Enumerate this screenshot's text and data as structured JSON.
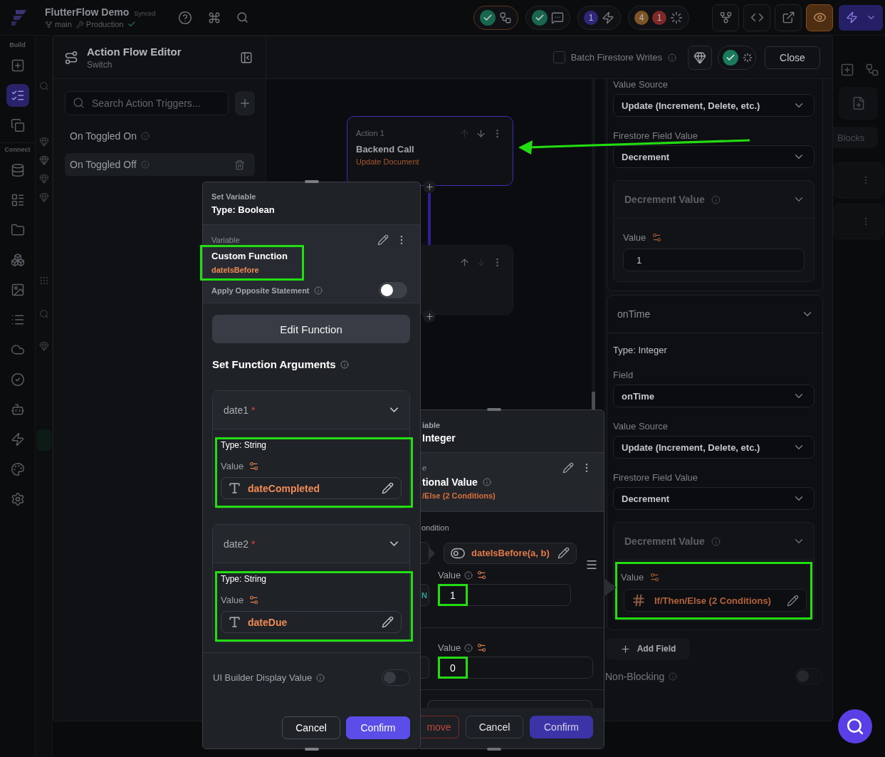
{
  "app_bar": {
    "project": "FlutterFlow Demo",
    "sync_status": "Synced",
    "branch": "main",
    "environment": "Production",
    "status_pills": [
      {
        "kind": "validation",
        "selected": true
      },
      {
        "kind": "comments",
        "selected": false
      },
      {
        "kind": "actions",
        "selected": false,
        "counts": [
          {
            "text": "1",
            "color": "#2f287a"
          }
        ]
      },
      {
        "kind": "issues",
        "selected": false,
        "counts": [
          {
            "text": "4",
            "color": "#7d5426"
          },
          {
            "text": "1",
            "color": "#7e2828"
          }
        ]
      }
    ],
    "tools": [
      {
        "kind": "branch",
        "on": false
      },
      {
        "kind": "code",
        "on": false
      },
      {
        "kind": "open",
        "on": false
      },
      {
        "kind": "preview",
        "on": true
      }
    ]
  },
  "rail": {
    "sections": [
      {
        "label": "Build",
        "items": [
          {
            "kind": "add-widget",
            "selected": false
          },
          {
            "kind": "widget-tree",
            "selected": true
          },
          {
            "kind": "components",
            "selected": false
          }
        ]
      },
      {
        "label": "Connect",
        "items": [
          {
            "kind": "database",
            "selected": false
          },
          {
            "kind": "schema",
            "selected": false
          },
          {
            "kind": "storage",
            "selected": false
          },
          {
            "kind": "integrations",
            "selected": false
          },
          {
            "kind": "media",
            "selected": false
          },
          {
            "kind": "text",
            "selected": false
          },
          {
            "kind": "cloud",
            "selected": false
          },
          {
            "kind": "tests",
            "selected": false
          },
          {
            "kind": "agent",
            "selected": false
          },
          {
            "kind": "actions",
            "selected": false
          },
          {
            "kind": "theme",
            "selected": false
          },
          {
            "kind": "settings",
            "selected": false
          }
        ]
      }
    ]
  },
  "backdrop": {
    "tab_label": "Blocks"
  },
  "action_flow_editor": {
    "title": "Action Flow Editor",
    "subtitle": "Switch",
    "batch_writes": {
      "label": "Batch Firestore Writes",
      "checked": false
    },
    "close_label": "Close",
    "trigger_search": {
      "placeholder": "Search Action Triggers..."
    },
    "triggers": [
      {
        "label": "On Toggled On",
        "selected": false
      },
      {
        "label": "On Toggled Off",
        "selected": true
      }
    ],
    "nodes": [
      {
        "caption": "Action 1",
        "title": "Backend Call",
        "subtitle": "Update Document",
        "selected": true,
        "can_move_up": false,
        "can_move_down": true
      },
      {
        "selected": false,
        "can_move_up": true,
        "can_move_down": false
      }
    ],
    "annotation_arrow": true
  },
  "update_fields": {
    "groups": [
      {
        "items": [
          {
            "kind": "select",
            "label": "Value Source",
            "value": "Update (Increment, Delete, etc.)"
          },
          {
            "kind": "select",
            "label": "Firestore Field Value",
            "value": "Decrement"
          },
          {
            "kind": "value",
            "title": "Decrement Value",
            "value_label": "Value",
            "field": {
              "kind": "literal",
              "value": "1"
            },
            "highlighted": false
          }
        ]
      },
      {
        "title": "onTime",
        "items": [
          {
            "kind": "type",
            "text": "Type: Integer"
          },
          {
            "kind": "select",
            "label": "Field",
            "value": "onTime"
          },
          {
            "kind": "select",
            "label": "Value Source",
            "value": "Update (Increment, Delete, etc.)"
          },
          {
            "kind": "select",
            "label": "Firestore Field Value",
            "value": "Decrement"
          },
          {
            "kind": "value",
            "title": "Decrement Value",
            "value_label": "Value",
            "field": {
              "kind": "expression",
              "value": "If/Then/Else (2 Conditions)"
            },
            "highlighted": true
          }
        ]
      }
    ],
    "add_field_label": "Add Field",
    "non_blocking": {
      "label": "Non-Blocking",
      "on": false
    }
  },
  "set_variable": {
    "caption": "Set Variable",
    "type": "Type: Boolean",
    "variable_label": "Variable",
    "source": "Custom Function",
    "source_detail": "dateIsBefore",
    "highlighted": true,
    "opposite": {
      "label": "Apply Opposite Statement",
      "on": false
    },
    "edit_label": "Edit Function",
    "arguments_title": "Set Function Arguments",
    "arguments": [
      {
        "name": "date1",
        "mark": "*",
        "type": "Type: String",
        "value_label": "Value",
        "value": "dateCompleted",
        "highlighted": true
      },
      {
        "name": "date2",
        "mark": "*",
        "type": "Type: String",
        "value_label": "Value",
        "value": "dateDue",
        "highlighted": true
      }
    ],
    "display_value": {
      "label": "UI Builder Display Value",
      "on": false,
      "disabled": true
    },
    "buttons": [
      {
        "label": "Cancel",
        "kind": "secondary"
      },
      {
        "label": "Confirm",
        "kind": "primary"
      }
    ]
  },
  "conditional_variable": {
    "caption": "iable",
    "type": "Integer",
    "variable_label": "e",
    "source": "tional Value",
    "source_detail": "/Else (2 Conditions)",
    "condition_label": "ondition",
    "condition": "dateIsBefore(a, b)",
    "branches": [
      {
        "tag": "N",
        "value_label": "Value",
        "value": "1",
        "highlighted": true
      },
      {
        "value_label": "Value",
        "value": "0",
        "highlighted": true
      }
    ],
    "buttons": [
      {
        "label": "move",
        "kind": "danger"
      },
      {
        "label": "Cancel",
        "kind": "secondary"
      },
      {
        "label": "Confirm",
        "kind": "primary"
      }
    ]
  }
}
